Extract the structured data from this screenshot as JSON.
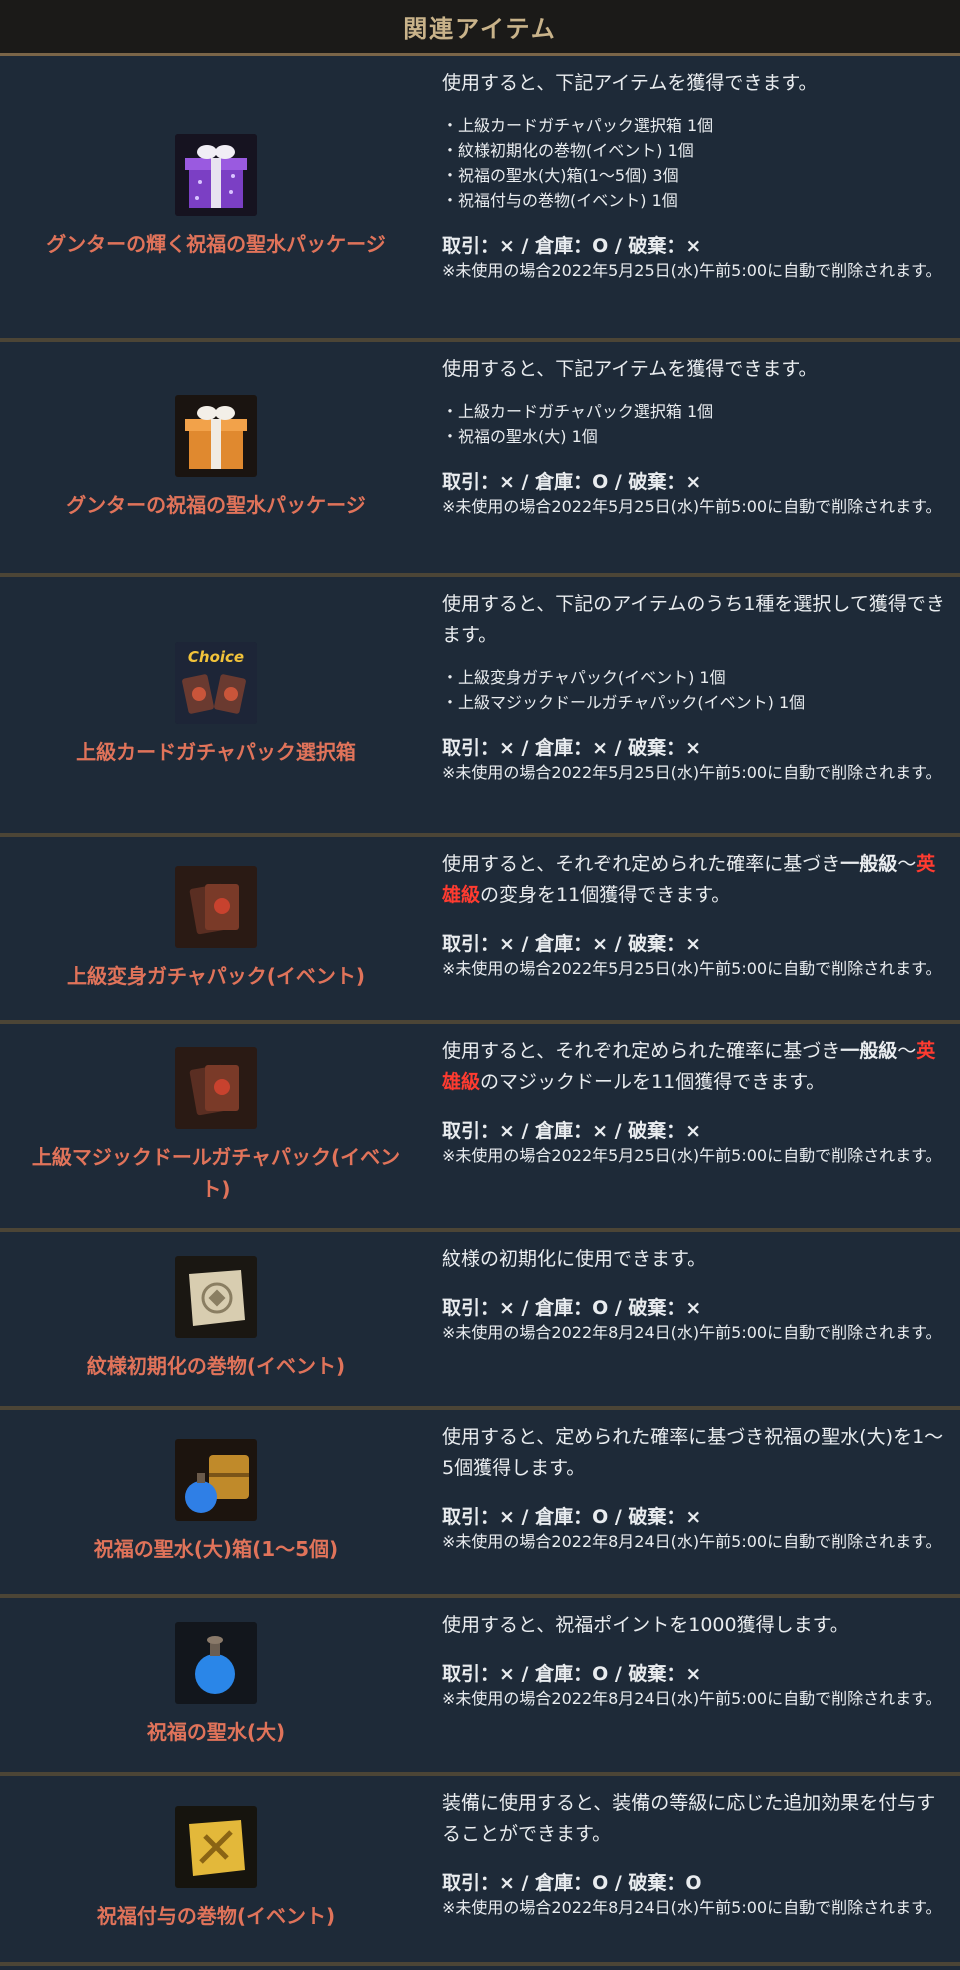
{
  "header": {
    "title": "関連アイテム"
  },
  "items": [
    {
      "name": "グンターの輝く祝福の聖水パッケージ",
      "icon": "purple-gift-box-icon",
      "desc": "使用すると、下記アイテムを獲得できます。",
      "list": [
        "上級カードガチャパック選択箱 1個",
        "紋様初期化の巻物(イベント) 1個",
        "祝福の聖水(大)箱(1～5個) 3個",
        "祝福付与の巻物(イベント) 1個"
      ],
      "trade": "取引：× / 倉庫：O / 破棄：×",
      "note": "※未使用の場合2022年5月25日(水)午前5:00に自動で削除されます。"
    },
    {
      "name": "グンターの祝福の聖水パッケージ",
      "icon": "orange-gift-box-icon",
      "desc": "使用すると、下記アイテムを獲得できます。",
      "list": [
        "上級カードガチャパック選択箱 1個",
        "祝福の聖水(大) 1個"
      ],
      "trade": "取引：× / 倉庫：O / 破棄：×",
      "note": "※未使用の場合2022年5月25日(水)午前5:00に自動で削除されます。"
    },
    {
      "name": "上級カードガチャパック選択箱",
      "icon": "choice-box-icon",
      "icon_text": "Choice",
      "desc": "使用すると、下記のアイテムのうち1種を選択して獲得できます。",
      "list": [
        "上級変身ガチャパック(イベント) 1個",
        "上級マジックドールガチャパック(イベント) 1個"
      ],
      "trade": "取引：× / 倉庫：× / 破棄：×",
      "note": "※未使用の場合2022年5月25日(水)午前5:00に自動で削除されます。"
    },
    {
      "name": "上級変身ガチャパック(イベント)",
      "icon": "transform-card-pack-icon",
      "desc_a": "使用すると、それぞれ定められた確率に基づき",
      "desc_b": "一般級",
      "desc_c": "～",
      "desc_d": "英雄級",
      "desc_e": "の変身を11個獲得できます。",
      "trade": "取引：× / 倉庫：× / 破棄：×",
      "note": "※未使用の場合2022年5月25日(水)午前5:00に自動で削除されます。"
    },
    {
      "name": "上級マジックドールガチャパック(イベント)",
      "icon": "magic-doll-card-pack-icon",
      "desc_a": "使用すると、それぞれ定められた確率に基づき",
      "desc_b": "一般級",
      "desc_c": "～",
      "desc_d": "英雄級",
      "desc_e": "のマジックドールを11個獲得できます。",
      "trade": "取引：× / 倉庫：× / 破棄：×",
      "note": "※未使用の場合2022年5月25日(水)午前5:00に自動で削除されます。"
    },
    {
      "name": "紋様初期化の巻物(イベント)",
      "icon": "scroll-icon",
      "desc": "紋様の初期化に使用できます。",
      "trade": "取引：× / 倉庫：O / 破棄：×",
      "note": "※未使用の場合2022年8月24日(水)午前5:00に自動で削除されます。"
    },
    {
      "name": "祝福の聖水(大)箱(1～5個)",
      "icon": "treasure-chest-potion-icon",
      "desc": "使用すると、定められた確率に基づき祝福の聖水(大)を1～5個獲得します。",
      "trade": "取引：× / 倉庫：O / 破棄：×",
      "note": "※未使用の場合2022年8月24日(水)午前5:00に自動で削除されます。"
    },
    {
      "name": "祝福の聖水(大)",
      "icon": "blue-potion-icon",
      "desc": "使用すると、祝福ポイントを1000獲得します。",
      "trade": "取引：× / 倉庫：O / 破棄：×",
      "note": "※未使用の場合2022年8月24日(水)午前5:00に自動で削除されます。"
    },
    {
      "name": "祝福付与の巻物(イベント)",
      "icon": "golden-scroll-icon",
      "desc": "装備に使用すると、装備の等級に応じた追加効果を付与することができます。",
      "trade": "取引：× / 倉庫：O / 破棄：O",
      "note": "※未使用の場合2022年8月24日(水)午前5:00に自動で削除されます。"
    }
  ]
}
